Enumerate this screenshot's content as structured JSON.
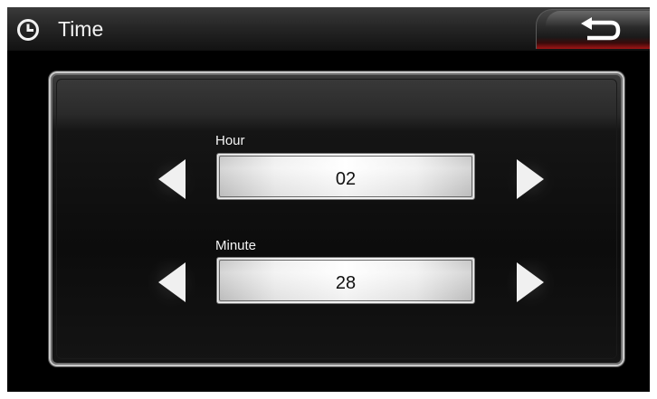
{
  "header": {
    "title": "Time",
    "clock_icon": "clock-icon",
    "back_icon": "return-arrow-icon"
  },
  "fields": [
    {
      "label": "Hour",
      "value": "02",
      "decrement_icon": "left-arrow-icon",
      "increment_icon": "right-arrow-icon"
    },
    {
      "label": "Minute",
      "value": "28",
      "decrement_icon": "left-arrow-icon",
      "increment_icon": "right-arrow-icon"
    }
  ],
  "colors": {
    "background": "#000000",
    "title_text": "#f2f2f2",
    "panel_border": "#c9c9c9",
    "value_text": "#111111",
    "back_button_accent": "#a31515"
  }
}
